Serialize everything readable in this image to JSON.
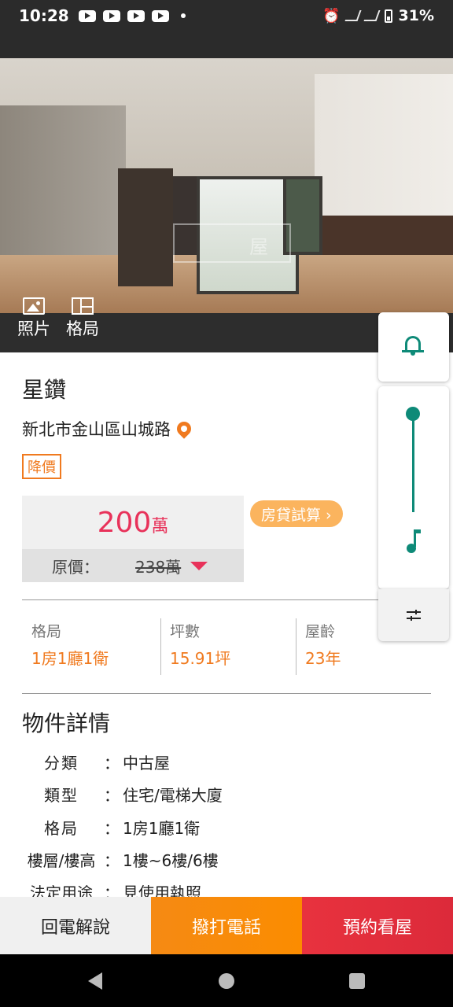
{
  "status_bar": {
    "time": "10:28",
    "battery": "31%"
  },
  "hero": {
    "watermark_text": "屋",
    "tools": [
      {
        "label": "照片",
        "icon": "photo-icon"
      },
      {
        "label": "格局",
        "icon": "floorplan-icon"
      }
    ]
  },
  "listing": {
    "title": "星鑽",
    "address": "新北市金山區山城路",
    "tag": "降價",
    "price": {
      "value": "200",
      "unit": "萬",
      "original_label": "原價：",
      "original_value": "238萬"
    },
    "loan_button": "房貸試算 ›",
    "specs": [
      {
        "label": "格局",
        "value": "1房1廳1衛"
      },
      {
        "label": "坪數",
        "value": "15.91坪"
      },
      {
        "label": "屋齡",
        "value": "23年"
      }
    ]
  },
  "details": {
    "title": "物件詳情",
    "rows": [
      {
        "key": "分類",
        "value": "中古屋"
      },
      {
        "key": "類型",
        "value": "住宅/電梯大廈"
      },
      {
        "key": "格局",
        "value": "1房1廳1衛"
      },
      {
        "key": "樓層/樓高",
        "value": "1樓~6樓/6樓"
      },
      {
        "key": "法定用途",
        "value": "見使用執照"
      }
    ],
    "colon": "："
  },
  "floating_panel": {
    "icons": [
      "bell-icon",
      "volume-slider",
      "music-note-icon",
      "tune-icon"
    ],
    "volume_level": 1.0
  },
  "actions": {
    "callback": "回電解說",
    "call": "撥打電話",
    "book": "預約看屋"
  },
  "colors": {
    "price_accent": "#e8325a",
    "orange_accent": "#f07a1f",
    "teal_accent": "#0e8a78"
  }
}
